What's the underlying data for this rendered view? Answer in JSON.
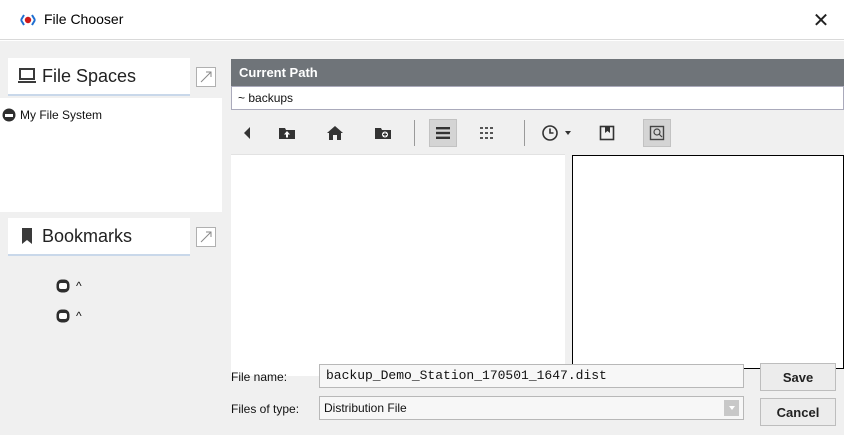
{
  "window": {
    "title": "File Chooser",
    "close_glyph": "✕",
    "icon": "niagara-eye-icon"
  },
  "left": {
    "file_spaces_tab": "File Spaces",
    "bookmarks_tab": "Bookmarks",
    "file_spaces": [
      {
        "label": "My File System",
        "icon": "drive-icon"
      }
    ],
    "bookmarks": [
      {
        "label": "^",
        "icon": "bookmark-host-icon"
      },
      {
        "label": "^",
        "icon": "bookmark-host-icon"
      }
    ]
  },
  "path": {
    "header": "Current Path",
    "value": "~ backups"
  },
  "toolbar": {
    "buttons": [
      "back-icon",
      "up-folder-icon",
      "home-icon",
      "new-folder-icon",
      "list-view-icon",
      "details-view-icon",
      "history-icon",
      "history-dropdown-icon",
      "bookmark-add-icon",
      "preview-toggle-icon"
    ]
  },
  "form": {
    "file_name_label": "File name:",
    "file_name_value": "backup_Demo_Station_170501_1647.dist",
    "file_type_label": "Files of type:",
    "file_type_value": "Distribution File"
  },
  "actions": {
    "save_label": "Save",
    "cancel_label": "Cancel"
  },
  "colors": {
    "path_header_bg": "#6f7479",
    "accent_blue": "#1f6fd1",
    "dark_icon": "#3a3a3a"
  }
}
